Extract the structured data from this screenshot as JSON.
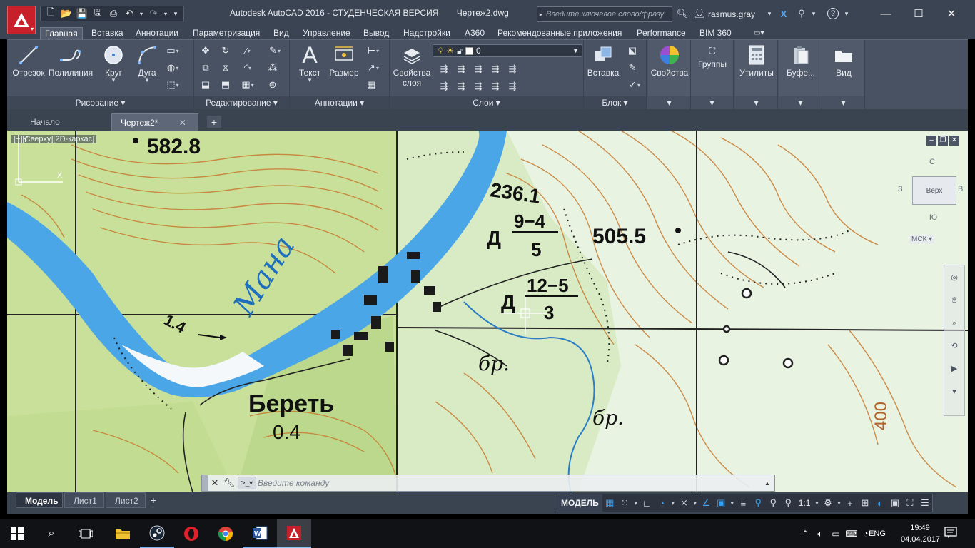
{
  "window": {
    "app_title": "Autodesk AutoCAD 2016 - СТУДЕНЧЕСКАЯ ВЕРСИЯ",
    "document_title": "Чертеж2.dwg",
    "search_placeholder": "Введите ключевое слово/фразу",
    "user": "rasmus.gray"
  },
  "ribbon_tabs": [
    "Главная",
    "Вставка",
    "Аннотации",
    "Параметризация",
    "Вид",
    "Управление",
    "Вывод",
    "Надстройки",
    "A360",
    "Рекомендованные приложения",
    "Performance",
    "BIM 360"
  ],
  "ribbon": {
    "draw": {
      "title": "Рисование",
      "line": "Отрезок",
      "polyline": "Полилиния",
      "circle": "Круг",
      "arc": "Дуга"
    },
    "modify": {
      "title": "Редактирование"
    },
    "annotation": {
      "title": "Аннотации",
      "text": "Текст",
      "dimension": "Размер"
    },
    "layers": {
      "title": "Слои",
      "properties": "Свойства слоя",
      "current_layer": "0"
    },
    "block": {
      "title": "Блок",
      "insert": "Вставка"
    },
    "properties": "Свойства",
    "groups": "Группы",
    "utilities": "Утилиты",
    "clipboard": "Буфе...",
    "view": "Вид"
  },
  "doc_tabs": {
    "start": "Начало",
    "drawing": "Чертеж2*"
  },
  "viewport": {
    "label": "[−][Сверху][2D-каркас]",
    "viewcube": {
      "face": "Верх",
      "north": "С",
      "south": "Ю",
      "west": "З",
      "east": "В"
    },
    "wcs": "МСК",
    "ucs_x": "X",
    "ucs_y": "Y"
  },
  "map": {
    "peak1": "582.8",
    "peak2": "505.5",
    "peak3": "236.1",
    "river": "Мана",
    "flow": "1.4",
    "village": "Береть",
    "village_value": "0.4",
    "ford1_top": "9−4",
    "ford1_bottom": "5",
    "ford2_top": "12−5",
    "ford2_bottom": "3",
    "ford_letter": "Д",
    "ford_letter2": "Д",
    "brod1": "бр.",
    "brod2": "бр.",
    "contour": "400"
  },
  "command_line": {
    "placeholder": "Введите команду"
  },
  "layout_tabs": [
    "Модель",
    "Лист1",
    "Лист2"
  ],
  "status": {
    "model": "МОДЕЛЬ",
    "scale": "1:1"
  },
  "taskbar": {
    "time": "19:49",
    "date": "04.04.2017",
    "language": "ENG"
  },
  "colors": {
    "title_bar": "#3b4453",
    "ribbon": "#485262",
    "map_forest": "#c9e29b",
    "map_open": "#eaf4e6",
    "river": "#4aa6e6",
    "contour": "#c77a2e"
  }
}
